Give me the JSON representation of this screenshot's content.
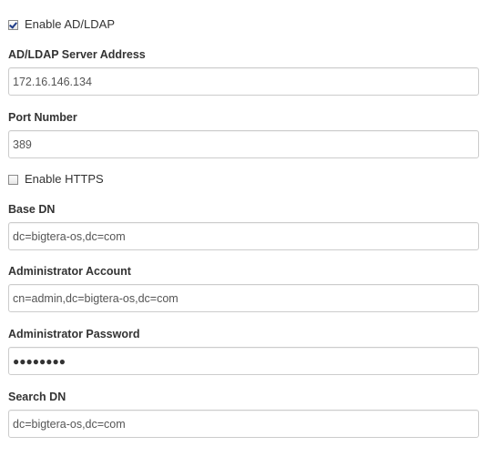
{
  "ldap_form": {
    "enable_ldap": {
      "label": "Enable AD/LDAP",
      "checked": true
    },
    "server_address": {
      "label": "AD/LDAP Server Address",
      "value": "172.16.146.134"
    },
    "port_number": {
      "label": "Port Number",
      "value": "389"
    },
    "enable_https": {
      "label": "Enable HTTPS",
      "checked": false
    },
    "base_dn": {
      "label": "Base DN",
      "value": "dc=bigtera-os,dc=com"
    },
    "admin_account": {
      "label": "Administrator Account",
      "value": "cn=admin,dc=bigtera-os,dc=com"
    },
    "admin_password": {
      "label": "Administrator Password",
      "masked_value": "●●●●●●●●"
    },
    "search_dn": {
      "label": "Search DN",
      "value": "dc=bigtera-os,dc=com"
    }
  }
}
